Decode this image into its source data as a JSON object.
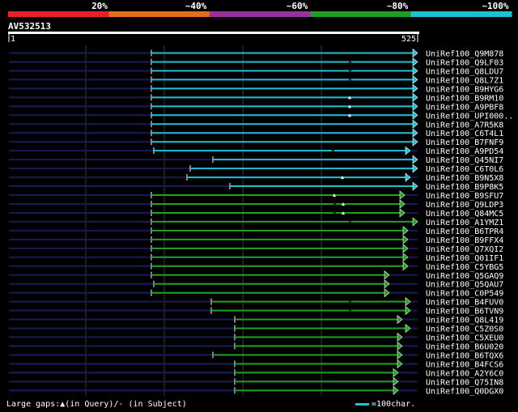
{
  "accession": "AV532513",
  "query_length_ticks": {
    "start": "1",
    "end": "525"
  },
  "identity_legend": [
    {
      "label": "20%",
      "color": "#e8202a"
    },
    {
      "label": "~40%",
      "color": "#e07020"
    },
    {
      "label": "~60%",
      "color": "#9a30a0"
    },
    {
      "label": "~80%",
      "color": "#20a020"
    },
    {
      "label": "~100%",
      "color": "#20c0d0"
    }
  ],
  "colors": {
    "background": "#000000",
    "query_line": "#ffffff",
    "rail": "#1a1a5a",
    "grid": "#3a3a3a",
    "cyan": "#20c0d0",
    "green": "#20a020",
    "gap_mark": "#ffffff",
    "label": "#ffffff"
  },
  "hits": [
    {
      "label": "UniRef100_Q9M878",
      "start": 187,
      "end": 516,
      "color": "cyan",
      "gaps_q": [],
      "gaps_s": []
    },
    {
      "label": "UniRef100_Q9LF03",
      "start": 187,
      "end": 516,
      "color": "cyan",
      "gaps_q": [],
      "gaps_s": [
        432
      ]
    },
    {
      "label": "UniRef100_Q8LDU7",
      "start": 187,
      "end": 516,
      "color": "cyan",
      "gaps_q": [],
      "gaps_s": [
        432
      ]
    },
    {
      "label": "UniRef100_Q8L7Z1",
      "start": 187,
      "end": 516,
      "color": "cyan",
      "gaps_q": [],
      "gaps_s": [
        432
      ]
    },
    {
      "label": "UniRef100_B9HYG6",
      "start": 187,
      "end": 516,
      "color": "cyan",
      "gaps_q": [],
      "gaps_s": []
    },
    {
      "label": "UniRef100_B9RM10",
      "start": 187,
      "end": 516,
      "color": "cyan",
      "gaps_q": [
        432
      ],
      "gaps_s": []
    },
    {
      "label": "UniRef100_A9PBF8",
      "start": 187,
      "end": 516,
      "color": "cyan",
      "gaps_q": [
        432
      ],
      "gaps_s": []
    },
    {
      "label": "UniRef100_UPI000..",
      "start": 187,
      "end": 516,
      "color": "cyan",
      "gaps_q": [
        432
      ],
      "gaps_s": []
    },
    {
      "label": "UniRef100_A7R5K8",
      "start": 187,
      "end": 516,
      "color": "cyan",
      "gaps_q": [],
      "gaps_s": []
    },
    {
      "label": "UniRef100_C6T4L1",
      "start": 187,
      "end": 516,
      "color": "cyan",
      "gaps_q": [],
      "gaps_s": []
    },
    {
      "label": "UniRef100_B7FNF9",
      "start": 187,
      "end": 516,
      "color": "cyan",
      "gaps_q": [],
      "gaps_s": []
    },
    {
      "label": "UniRef100_A9PD54",
      "start": 190,
      "end": 507,
      "color": "cyan",
      "gaps_q": [],
      "gaps_s": [
        411
      ]
    },
    {
      "label": "UniRef100_Q45NI7",
      "start": 263,
      "end": 516,
      "color": "cyan",
      "gaps_q": [],
      "gaps_s": []
    },
    {
      "label": "UniRef100_C6T0L6",
      "start": 235,
      "end": 516,
      "color": "cyan",
      "gaps_q": [],
      "gaps_s": []
    },
    {
      "label": "UniRef100_B9N5X8",
      "start": 231,
      "end": 507,
      "color": "cyan",
      "gaps_q": [
        423
      ],
      "gaps_s": []
    },
    {
      "label": "UniRef100_B9P8K5",
      "start": 284,
      "end": 516,
      "color": "cyan",
      "gaps_q": [],
      "gaps_s": []
    },
    {
      "label": "UniRef100_B9SFU7",
      "start": 187,
      "end": 500,
      "color": "green",
      "gaps_q": [
        413
      ],
      "gaps_s": []
    },
    {
      "label": "UniRef100_Q9LDP3",
      "start": 187,
      "end": 500,
      "color": "green",
      "gaps_q": [
        424
      ],
      "gaps_s": [
        413
      ]
    },
    {
      "label": "UniRef100_Q84MC5",
      "start": 187,
      "end": 500,
      "color": "green",
      "gaps_q": [
        424
      ],
      "gaps_s": [
        413
      ]
    },
    {
      "label": "UniRef100_A1YMZ1",
      "start": 187,
      "end": 516,
      "color": "green",
      "gaps_q": [],
      "gaps_s": [
        432
      ]
    },
    {
      "label": "UniRef100_B6TPR4",
      "start": 187,
      "end": 504,
      "color": "green",
      "gaps_q": [],
      "gaps_s": []
    },
    {
      "label": "UniRef100_B9FFX4",
      "start": 187,
      "end": 504,
      "color": "green",
      "gaps_q": [],
      "gaps_s": []
    },
    {
      "label": "UniRef100_Q7XQI2",
      "start": 187,
      "end": 504,
      "color": "green",
      "gaps_q": [],
      "gaps_s": []
    },
    {
      "label": "UniRef100_Q01IF1",
      "start": 187,
      "end": 504,
      "color": "green",
      "gaps_q": [],
      "gaps_s": []
    },
    {
      "label": "UniRef100_C5YBG5",
      "start": 187,
      "end": 504,
      "color": "green",
      "gaps_q": [],
      "gaps_s": []
    },
    {
      "label": "UniRef100_Q5GAQ9",
      "start": 187,
      "end": 481,
      "color": "green",
      "gaps_q": [],
      "gaps_s": []
    },
    {
      "label": "UniRef100_Q5QAU7",
      "start": 190,
      "end": 481,
      "color": "green",
      "gaps_q": [],
      "gaps_s": []
    },
    {
      "label": "UniRef100_C0P549",
      "start": 187,
      "end": 481,
      "color": "green",
      "gaps_q": [],
      "gaps_s": []
    },
    {
      "label": "UniRef100_B4FUV0",
      "start": 261,
      "end": 507,
      "color": "green",
      "gaps_q": [],
      "gaps_s": [
        432
      ]
    },
    {
      "label": "UniRef100_B6TVN9",
      "start": 261,
      "end": 507,
      "color": "green",
      "gaps_q": [],
      "gaps_s": [
        432
      ]
    },
    {
      "label": "UniRef100_Q8L419",
      "start": 290,
      "end": 497,
      "color": "green",
      "gaps_q": [],
      "gaps_s": []
    },
    {
      "label": "UniRef100_C5Z0S0",
      "start": 290,
      "end": 507,
      "color": "green",
      "gaps_q": [],
      "gaps_s": []
    },
    {
      "label": "UniRef100_C5XEU0",
      "start": 290,
      "end": 497,
      "color": "green",
      "gaps_q": [],
      "gaps_s": []
    },
    {
      "label": "UniRef100_B6U020",
      "start": 290,
      "end": 497,
      "color": "green",
      "gaps_q": [],
      "gaps_s": []
    },
    {
      "label": "UniRef100_B6TQX6",
      "start": 263,
      "end": 497,
      "color": "green",
      "gaps_q": [],
      "gaps_s": []
    },
    {
      "label": "UniRef100_B4FCS6",
      "start": 290,
      "end": 497,
      "color": "green",
      "gaps_q": [],
      "gaps_s": []
    },
    {
      "label": "UniRef100_A2Y6C0",
      "start": 290,
      "end": 492,
      "color": "green",
      "gaps_q": [],
      "gaps_s": []
    },
    {
      "label": "UniRef100_Q75IN8",
      "start": 290,
      "end": 492,
      "color": "green",
      "gaps_q": [],
      "gaps_s": []
    },
    {
      "label": "UniRef100_Q0DGX0",
      "start": 290,
      "end": 492,
      "color": "green",
      "gaps_q": [],
      "gaps_s": []
    }
  ],
  "footer": {
    "legend_text": "Large gaps:▲(in Query)/- (in Subject)",
    "scale_text": "=100char."
  }
}
